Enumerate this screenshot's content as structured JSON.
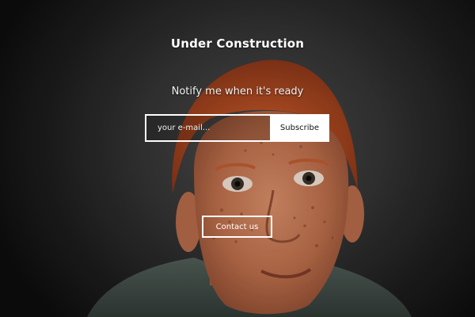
{
  "page": {
    "title": "Under Construction",
    "subtitle": "Notify me when it's ready"
  },
  "subscribe": {
    "email_placeholder": "your e-mail...",
    "email_value": "",
    "button_label": "Subscribe"
  },
  "contact": {
    "button_label": "Contact us"
  },
  "colors": {
    "background_dark": "#1c1c1c",
    "text": "#ffffff",
    "button_bg": "#ffffff",
    "button_text": "#111111"
  }
}
